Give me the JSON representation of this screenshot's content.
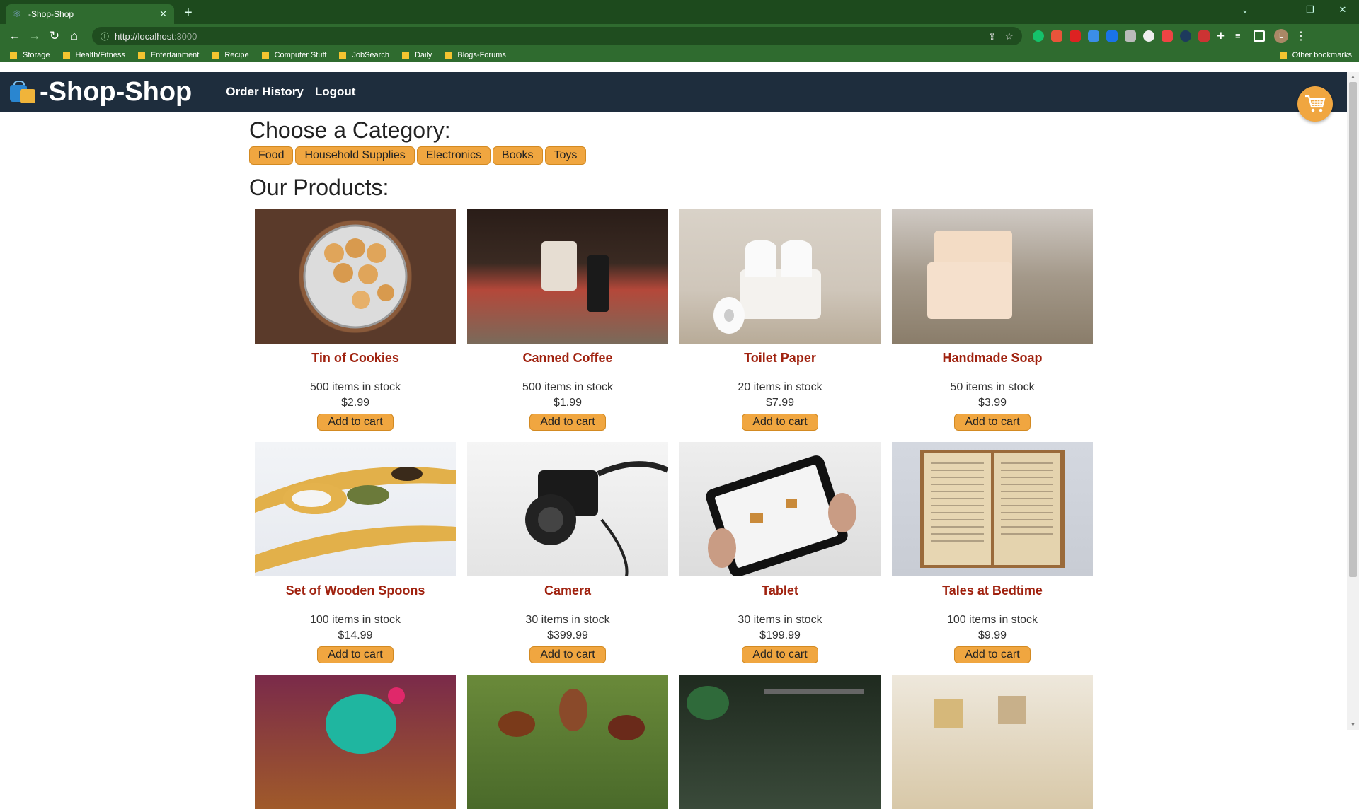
{
  "browser": {
    "tab_title": "-Shop-Shop",
    "url_host": "http://localhost",
    "url_port": ":3000",
    "bookmarks": [
      "Storage",
      "Health/Fitness",
      "Entertainment",
      "Recipe",
      "Computer Stuff",
      "JobSearch",
      "Daily",
      "Blogs-Forums"
    ],
    "other_bookmarks": "Other bookmarks",
    "profile_initial": "L"
  },
  "header": {
    "brand": "-Shop-Shop",
    "nav": [
      "Order History",
      "Logout"
    ]
  },
  "categories_heading": "Choose a Category:",
  "categories": [
    "Food",
    "Household Supplies",
    "Electronics",
    "Books",
    "Toys"
  ],
  "products_heading": "Our Products:",
  "add_label": "Add to cart",
  "products": [
    {
      "name": "Tin of Cookies",
      "stock": "500 items in stock",
      "price": "$2.99"
    },
    {
      "name": "Canned Coffee",
      "stock": "500 items in stock",
      "price": "$1.99"
    },
    {
      "name": "Toilet Paper",
      "stock": "20 items in stock",
      "price": "$7.99"
    },
    {
      "name": "Handmade Soap",
      "stock": "50 items in stock",
      "price": "$3.99"
    },
    {
      "name": "Set of Wooden Spoons",
      "stock": "100 items in stock",
      "price": "$14.99"
    },
    {
      "name": "Camera",
      "stock": "30 items in stock",
      "price": "$399.99"
    },
    {
      "name": "Tablet",
      "stock": "30 items in stock",
      "price": "$199.99"
    },
    {
      "name": "Tales at Bedtime",
      "stock": "100 items in stock",
      "price": "$9.99"
    }
  ],
  "colors": {
    "header_bg": "#1e2d3d",
    "accent": "#f0a640",
    "product_name": "#a0220f",
    "browser_frame": "#2f6b2f"
  }
}
